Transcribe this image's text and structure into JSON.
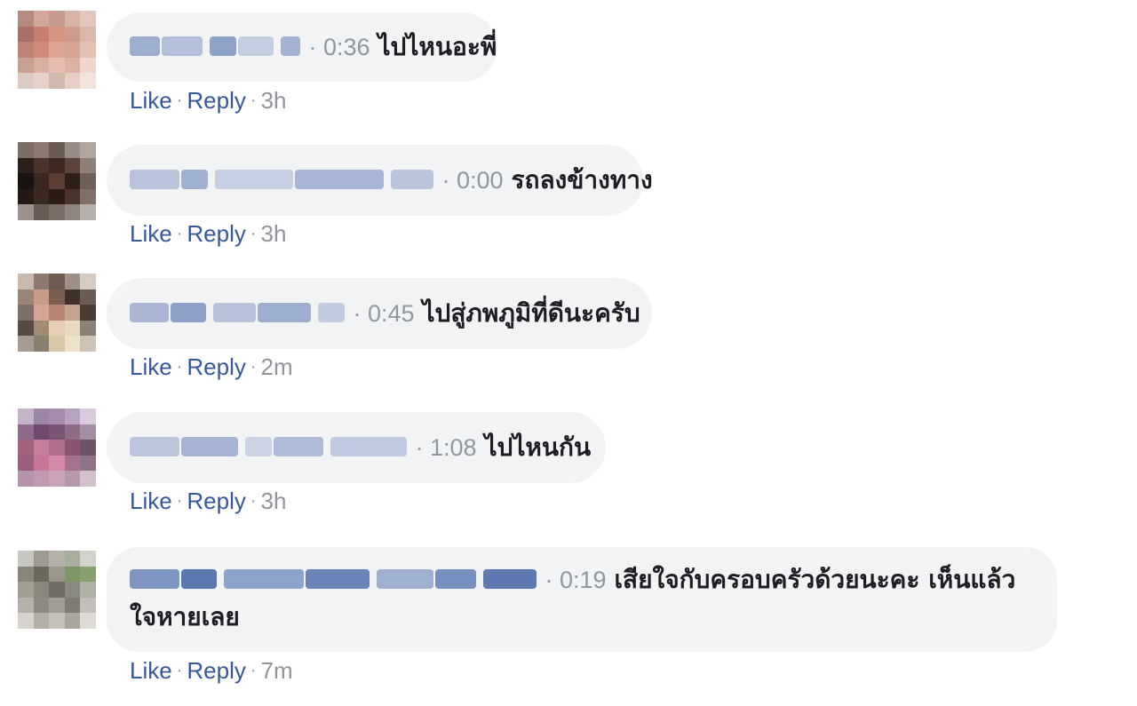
{
  "comments": [
    {
      "time_marker": "0:36",
      "text": "ไปไหนอะพี่",
      "like_label": "Like",
      "reply_label": "Reply",
      "age": "3h",
      "avatar_colors": [
        "#b58a80",
        "#d4a79c",
        "#c99a8f",
        "#d8b3a8",
        "#e2c7bd",
        "#a87066",
        "#c77f71",
        "#d59684",
        "#ce9a8c",
        "#dcb8ab",
        "#bd8576",
        "#d08b7b",
        "#e0a494",
        "#d7a393",
        "#e3c2b6",
        "#c9a193",
        "#d9b0a2",
        "#e6bdb0",
        "#ddb2a4",
        "#eed6cc",
        "#dccbc3",
        "#e6d2c8",
        "#d0b8ab",
        "#e6d0c5",
        "#f2e4dd"
      ],
      "name_blur_colors": [
        "#9eaed0",
        "#b3c0da",
        "#8fa2c8",
        "#c4cee2",
        "#a4b3d2"
      ]
    },
    {
      "time_marker": "0:00",
      "text": "รถลงข้างทาง",
      "like_label": "Like",
      "reply_label": "Reply",
      "age": "3h",
      "avatar_colors": [
        "#7d6e64",
        "#8a7a70",
        "#6b5c53",
        "#978b83",
        "#b0a69f",
        "#2b1f1a",
        "#4a342a",
        "#3e2a22",
        "#5a4337",
        "#8e7f77",
        "#1a120e",
        "#3a271f",
        "#5b3f33",
        "#2e1e18",
        "#6e6059",
        "#241914",
        "#3b2922",
        "#2a1c16",
        "#4a352d",
        "#807069",
        "#9c918b",
        "#6a5c55",
        "#7b6d66",
        "#8f847f",
        "#b8b0ab"
      ],
      "name_blur_colors": [
        "#b9c4dc",
        "#9fb0d1",
        "#c7d0e3",
        "#a7b6d4",
        "#bac5dc"
      ]
    },
    {
      "time_marker": "0:45",
      "text": "ไปสู่ภพภูมิที่ดีนะครับ",
      "like_label": "Like",
      "reply_label": "Reply",
      "age": "2m",
      "avatar_colors": [
        "#c9b9ad",
        "#8d7a6e",
        "#6e5c52",
        "#a08f84",
        "#d5ccc4",
        "#9a8477",
        "#c79a89",
        "#7b5e50",
        "#3f3029",
        "#6a5b54",
        "#7e6f66",
        "#d4a594",
        "#b98674",
        "#c4a28f",
        "#4b3c35",
        "#574a40",
        "#a08c72",
        "#e5cdb8",
        "#ead9c1",
        "#8c8176",
        "#a69c92",
        "#8a7f6d",
        "#d9c8a8",
        "#efe2c8",
        "#cdc3b6"
      ],
      "name_blur_colors": [
        "#a8b6d3",
        "#8ea0c8",
        "#b7c3db",
        "#9cadcf",
        "#c2cce1"
      ]
    },
    {
      "time_marker": "1:08",
      "text": "ไปไหนกัน",
      "like_label": "Like",
      "reply_label": "Reply",
      "age": "3h",
      "avatar_colors": [
        "#c7b3c9",
        "#9b86a5",
        "#a58aae",
        "#b8a3bf",
        "#d9cadd",
        "#8e6a8c",
        "#6f4a6c",
        "#7a5573",
        "#8d6d88",
        "#a68da6",
        "#a2637f",
        "#c47e9b",
        "#b06d8c",
        "#8b5474",
        "#6e5266",
        "#9a5f7e",
        "#c87597",
        "#d48aa8",
        "#a4728e",
        "#8c7387",
        "#b593ac",
        "#c299b3",
        "#c9a3ba",
        "#b598ac",
        "#d2c0cd"
      ],
      "name_blur_colors": [
        "#bcc7de",
        "#a5b4d2",
        "#cbd3e5",
        "#aebcd7",
        "#c0cae0"
      ]
    },
    {
      "time_marker": "0:19",
      "text": "เสียใจกับครอบครัวด้วยนะคะ เห็นแล้ว ใจหายเลย",
      "like_label": "Like",
      "reply_label": "Reply",
      "age": "7m",
      "avatar_colors": [
        "#c8c6c0",
        "#9e9a92",
        "#b6b2a9",
        "#a9ad9c",
        "#d2d4cc",
        "#8a8579",
        "#6d685e",
        "#9a968b",
        "#7c9665",
        "#86a06f",
        "#a29d93",
        "#8b867c",
        "#6e6b62",
        "#8a8a7e",
        "#b0b0a6",
        "#b5b0a8",
        "#8f8a80",
        "#a39e95",
        "#7f7b72",
        "#c2bfb8",
        "#d6d3cd",
        "#b3afa7",
        "#c6c2bb",
        "#aaa69f",
        "#dedbd5"
      ],
      "name_blur_colors": [
        "#7f96c2",
        "#5d77b0",
        "#8ea3cb",
        "#6c84b8",
        "#9fb1d3",
        "#7890c0",
        "#5f78b2"
      ]
    }
  ]
}
